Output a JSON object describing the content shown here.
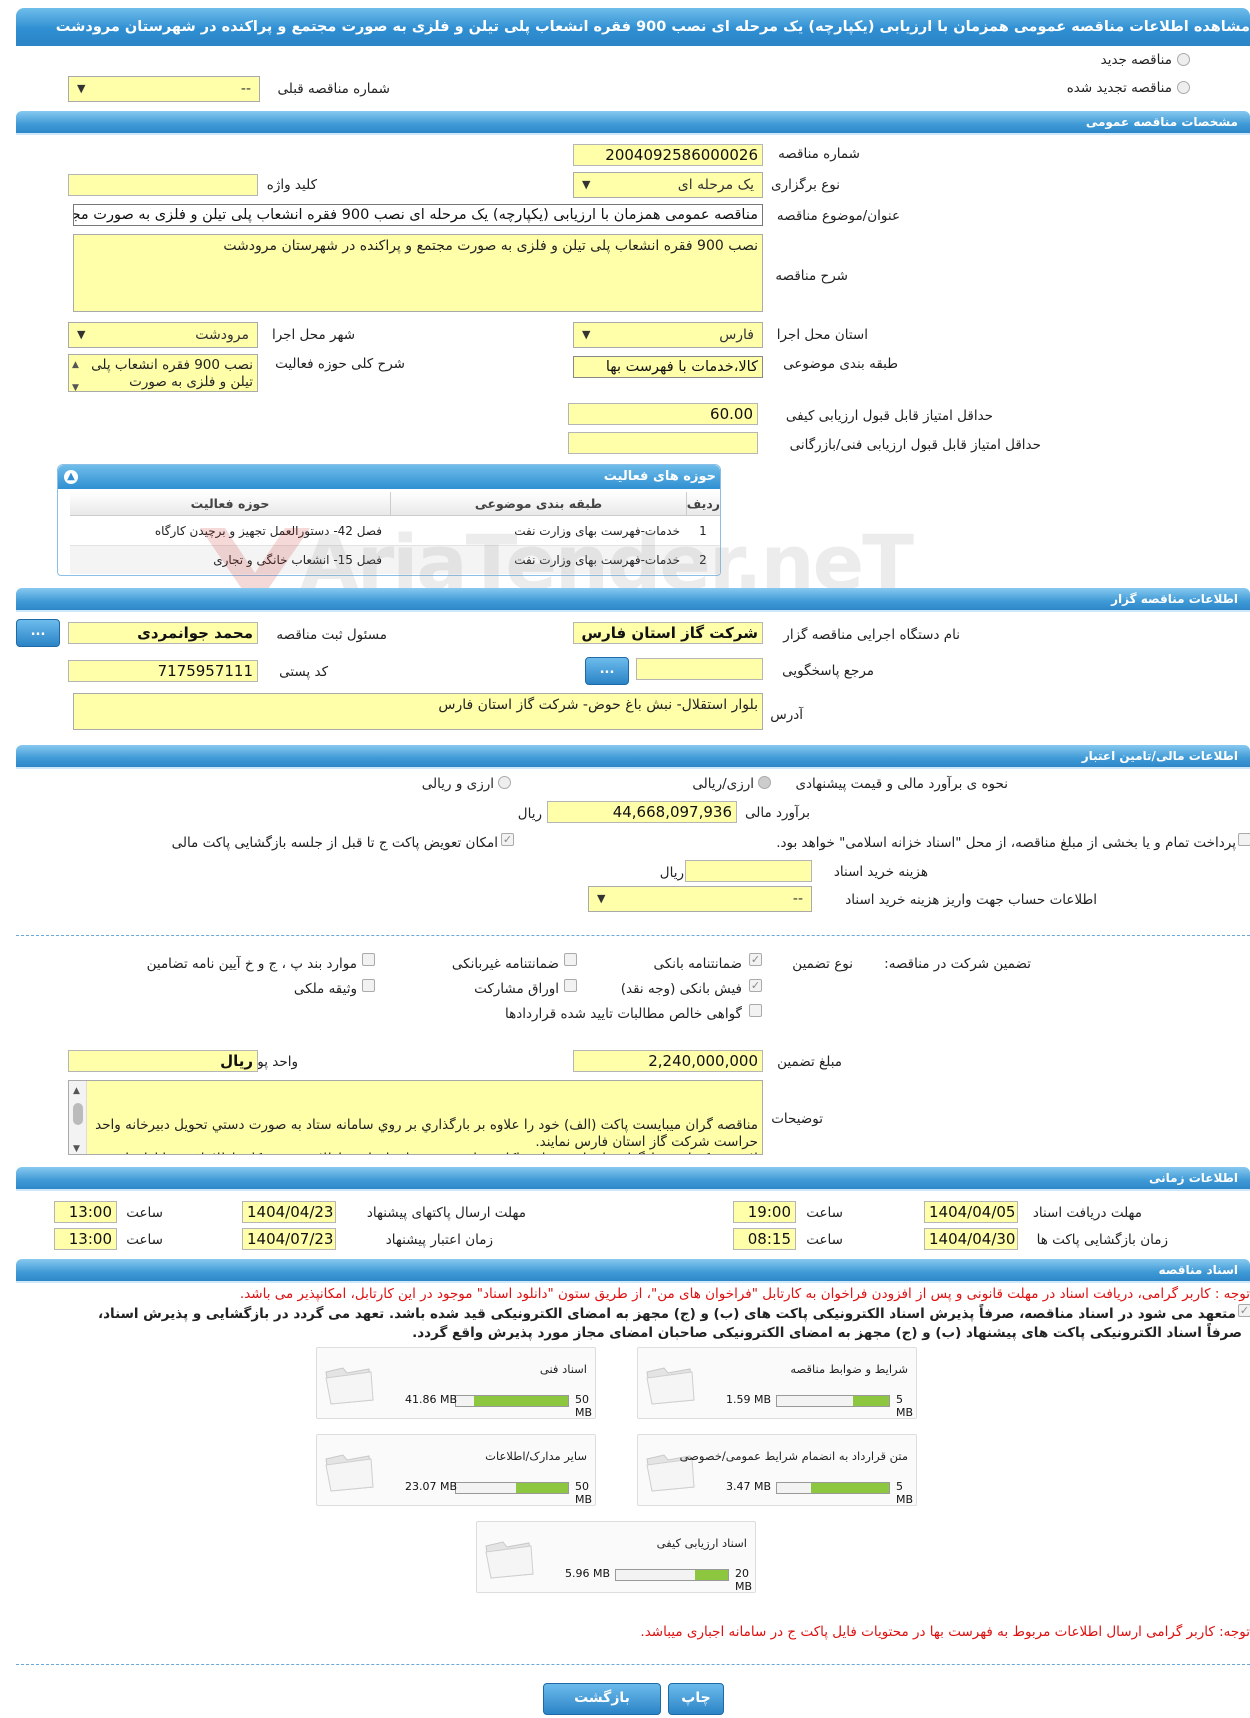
{
  "title": "مشاهده اطلاعات مناقصه عمومی همزمان با ارزیابی (یکپارچه) یک مرحله ای نصب 900 فقره انشعاب پلی تیلن و فلزی به صورت مجتمع و پراکنده در شهرستان مرودشت",
  "top": {
    "new_tender": "مناقصه جدید",
    "renewed_tender": "مناقصه تجدید شده",
    "prev_number_label": "شماره مناقصه قبلی",
    "prev_number_value": "--"
  },
  "sections": {
    "general": "مشخصات مناقصه عمومی",
    "organizer": "اطلاعات مناقصه گزار",
    "financial": "اطلاعات مالی/تامین اعتبار",
    "timing": "اطلاعات زمانی",
    "documents": "اسناد مناقصه"
  },
  "general": {
    "number_label": "شماره مناقصه",
    "number": "2004092586000026",
    "type_label": "نوع برگزاری",
    "type": "یک مرحله ای",
    "keyword_label": "کلید واژه",
    "keyword": "",
    "subject_label": "عنوان/موضوع مناقصه",
    "subject": "مناقصه عمومی همزمان با ارزیابی (یکپارچه) یک مرحله ای نصب 900 فقره انشعاب پلی تیلن و فلزی به صورت مجتمع و پراکنده در شهرستان مرودشت",
    "desc_label": "شرح مناقصه",
    "desc": "نصب 900 فقره انشعاب پلی تیلن و فلزی به صورت مجتمع و پراکنده در شهرستان مرودشت",
    "province_label": "استان محل اجرا",
    "province": "فارس",
    "city_label": "شهر محل اجرا",
    "city": "مرودشت",
    "category_label": "طبقه بندی موضوعی",
    "category": "کالا،خدمات با فهرست بها",
    "activity_desc_label": "شرح کلی حوزه فعالیت",
    "activity_desc": "نصب 900 فقره انشعاب پلی تیلن و فلزی به صورت",
    "min_quality_label": "حداقل امتیاز قابل قبول ارزیابی کیفی",
    "min_quality": "60.00",
    "min_tech_label": "حداقل امتیاز قابل قبول ارزیابی فنی/بازرگانی",
    "min_tech": ""
  },
  "activities": {
    "title": "حوزه های فعالیت",
    "col_row": "ردیف",
    "col_category": "طبقه بندی موضوعی",
    "col_field": "حوزه فعالیت",
    "rows": [
      {
        "n": "1",
        "category": "خدمات-فهرست بهای وزارت نفت",
        "field": "فصل 42- دستورالعمل تجهیز و برچیدن کارگاه"
      },
      {
        "n": "2",
        "category": "خدمات-فهرست بهای وزارت نفت",
        "field": "فصل 15- انشعاب خانگی و تجاری"
      }
    ]
  },
  "organizer": {
    "org_label": "نام دستگاه اجرایی مناقصه گزار",
    "org": "شرکت گاز استان فارس",
    "resp_label": "مسئول ثبت مناقصه",
    "resp": "محمد  جوانمردی",
    "ref_label": "مرجع پاسخگویی",
    "ref": "",
    "postal_label": "کد پستی",
    "postal": "7175957111",
    "addr_label": "آدرس",
    "addr": "بلوار استقلال- نبش باغ حوض- شرکت گاز استان فارس",
    "dots": "..."
  },
  "financial": {
    "method_label": "نحوه ی برآورد مالی و قیمت پیشنهادی",
    "rial": "ارزی/ریالی",
    "rial_and": "ارزی و ریالی",
    "estimate_label": "برآورد مالی",
    "estimate": "44,668,097,936",
    "unit": "ریال",
    "treasury": "پرداخت تمام و یا بخشی از مبلغ مناقصه، از محل \"اسناد خزانه اسلامی\" خواهد بود.",
    "swap": "امکان تعویض پاکت ج تا قبل از جلسه بازگشایی پاکت مالی",
    "doc_cost_label": "هزینه خرید اسناد",
    "doc_cost": "",
    "account_label": "اطلاعات حساب جهت واریز هزینه خرید اسناد",
    "account": "--",
    "guarantee_label": "تضمین شرکت در مناقصه:",
    "gtype_label": "نوع تضمین",
    "g_bank": "ضمانتنامه بانکی",
    "g_nonbank": "ضمانتنامه غیربانکی",
    "g_items": "موارد بند پ ، ج و خ آیین نامه تضامین",
    "g_check": "فیش بانکی (وجه نقد)",
    "g_bonds": "اوراق مشارکت",
    "g_property": "وثیقه ملکی",
    "g_claims": "گواهی خالص مطالبات تایید شده قراردادها",
    "amount_label": "مبلغ تضمین",
    "amount": "2,240,000,000",
    "currency_label": "واحد پول",
    "currency": "ریال",
    "notes_label": "توضیحات",
    "notes": "مناقصه گران میبایست پاکت (الف) خود را علاوه بر بارگذاري بر روي سامانه ستاد به صورت دستي تحویل دبیرخانه واحد حراست شرکت گاز استان فارس نمایند.\nلازم به ذکر است بارگذاري اسناد و تسلیم پاکات مناقصه به منزله  اقرار به اطلاع و رویت کلیه اطلاعات و فایلهاي این پروژه در سامانه ستاد میباشد."
  },
  "timing": {
    "receive_label": "مهلت دریافت اسناد",
    "receive_date": "1404/04/05",
    "receive_time": "19:00",
    "send_label": "مهلت ارسال پاکتهای پیشنهاد",
    "send_date": "1404/04/23",
    "send_time": "13:00",
    "open_label": "زمان بازگشایی پاکت ها",
    "open_date": "1404/04/30",
    "open_time": "08:15",
    "valid_label": "زمان اعتبار پیشنهاد",
    "valid_date": "1404/07/23",
    "valid_time": "13:00",
    "time_label": "ساعت"
  },
  "docs": {
    "note1": "توجه : کاربر گرامی، دریافت اسناد در مهلت قانونی و پس از افزودن فراخوان به کارتابل \"فراخوان های من\"، از طریق ستون \"دانلود اسناد\" موجود در این کارتابل، امکانپذیر می باشد.",
    "commit1": "متعهد می شود در اسناد مناقصه، صرفاً پذیرش اسناد الکترونیکی پاکت های (ب) و (ج) مجهز به امضای الکترونیکی قید شده باشد. تعهد می گردد در بازگشایی و پذیرش اسناد،",
    "commit2": "صرفاً اسناد الکترونیکی پاکت های پیشنهاد (ب) و (ج) مجهز به امضای الکترونیکی صاحبان امضای مجاز مورد پذیرش واقع گردد.",
    "files": [
      {
        "name": "شرایط و ضوابط مناقصه",
        "size": "1.59 MB",
        "max": "5 MB",
        "pct": 31.8
      },
      {
        "name": "اسناد فنی",
        "size": "41.86 MB",
        "max": "50 MB",
        "pct": 83.7
      },
      {
        "name": "متن قرارداد به انضمام شرایط عمومی/خصوصی",
        "size": "3.47 MB",
        "max": "5 MB",
        "pct": 69.4
      },
      {
        "name": "سایر مدارک/اطلاعات",
        "size": "23.07 MB",
        "max": "50 MB",
        "pct": 46.1
      },
      {
        "name": "اسناد ارزیابی کیفی",
        "size": "5.96 MB",
        "max": "20 MB",
        "pct": 29.8
      }
    ],
    "note2": "توجه: کاربر گرامی ارسال اطلاعات مربوط به فهرست بها در محتویات فایل پاکت ج در سامانه اجباری میباشد."
  },
  "buttons": {
    "print": "چاپ",
    "back": "بازگشت"
  },
  "watermark": "AriaTender.neT"
}
